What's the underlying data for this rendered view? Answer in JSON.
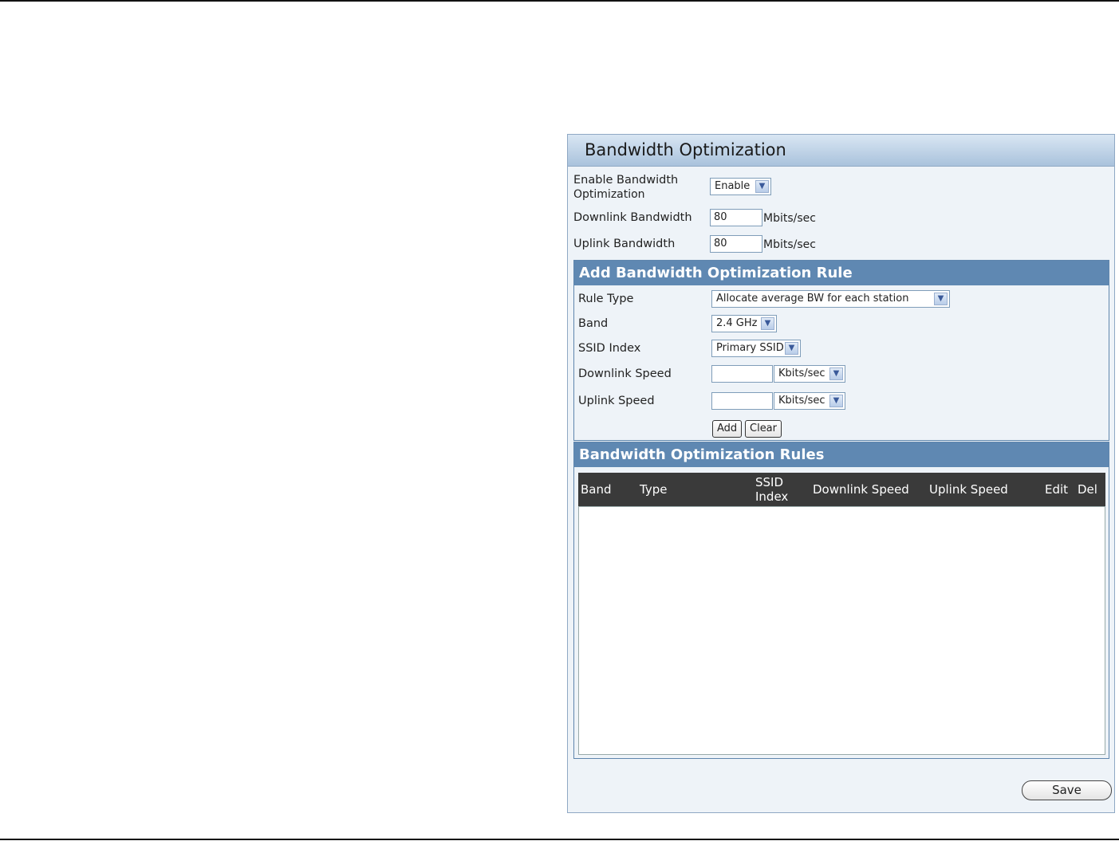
{
  "panel": {
    "title": "Bandwidth Optimization",
    "enable_label_line1": "Enable Bandwidth",
    "enable_label_line2": "Optimization",
    "enable_value": "Enable",
    "downlink_bw_label": "Downlink Bandwidth",
    "downlink_bw_value": "80",
    "downlink_bw_unit": "Mbits/sec",
    "uplink_bw_label": "Uplink Bandwidth",
    "uplink_bw_value": "80",
    "uplink_bw_unit": "Mbits/sec"
  },
  "add_rule": {
    "title": "Add Bandwidth Optimization Rule",
    "rule_type_label": "Rule Type",
    "rule_type_value": "Allocate average BW for each station",
    "band_label": "Band",
    "band_value": "2.4 GHz",
    "ssid_label": "SSID Index",
    "ssid_value": "Primary SSID",
    "downlink_speed_label": "Downlink Speed",
    "downlink_speed_value": "",
    "downlink_speed_unit": "Kbits/sec",
    "uplink_speed_label": "Uplink Speed",
    "uplink_speed_value": "",
    "uplink_speed_unit": "Kbits/sec",
    "add_label": "Add",
    "clear_label": "Clear"
  },
  "rules": {
    "title": "Bandwidth Optimization Rules",
    "columns": {
      "band": "Band",
      "type": "Type",
      "ssid_line1": "SSID",
      "ssid_line2": "Index",
      "downlink": "Downlink Speed",
      "uplink": "Uplink Speed",
      "edit": "Edit",
      "del": "Del"
    },
    "rows": []
  },
  "save_label": "Save",
  "icons": {
    "dropdown": "chevron-down-icon"
  }
}
